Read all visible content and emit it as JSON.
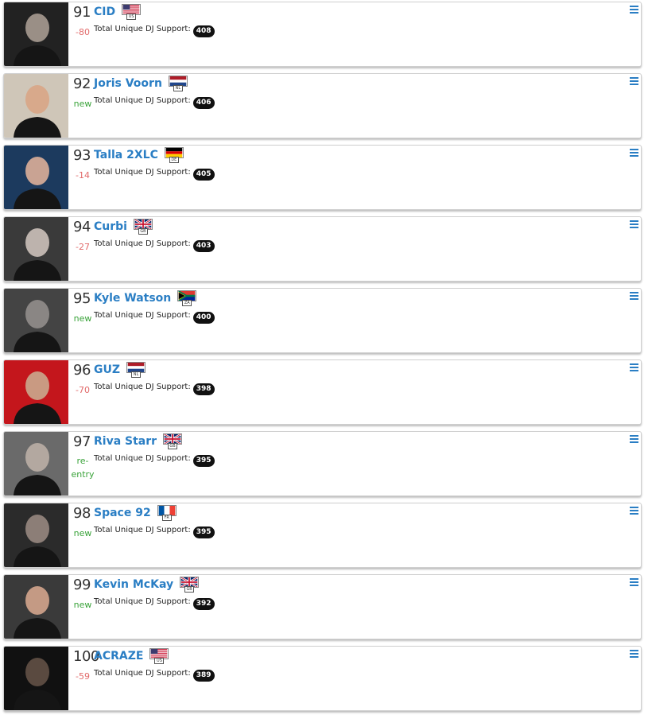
{
  "support_label": "Total Unique DJ Support:",
  "colors": {
    "name_link": "#2a7ec4",
    "down": "#e26b6b",
    "up": "#3aa33a"
  },
  "entries": [
    {
      "rank": "91",
      "name": "CID",
      "country": "US",
      "change": "-80",
      "change_type": "down",
      "support": "408",
      "photo_icon": "artist-photo"
    },
    {
      "rank": "92",
      "name": "Joris Voorn",
      "country": "NL",
      "change": "new",
      "change_type": "up",
      "support": "406",
      "photo_icon": "artist-photo"
    },
    {
      "rank": "93",
      "name": "Talla 2XLC",
      "country": "DE",
      "change": "-14",
      "change_type": "down",
      "support": "405",
      "photo_icon": "artist-photo"
    },
    {
      "rank": "94",
      "name": "Curbi",
      "country": "GB",
      "change": "-27",
      "change_type": "down",
      "support": "403",
      "photo_icon": "artist-photo"
    },
    {
      "rank": "95",
      "name": "Kyle Watson",
      "country": "ZA",
      "change": "new",
      "change_type": "up",
      "support": "400",
      "photo_icon": "artist-photo"
    },
    {
      "rank": "96",
      "name": "GUZ",
      "country": "NL",
      "change": "-70",
      "change_type": "down",
      "support": "398",
      "photo_icon": "artist-photo"
    },
    {
      "rank": "97",
      "name": "Riva Starr",
      "country": "GB",
      "change": "re-\nentry",
      "change_type": "up",
      "support": "395",
      "photo_icon": "artist-photo"
    },
    {
      "rank": "98",
      "name": "Space 92",
      "country": "FR",
      "change": "new",
      "change_type": "up",
      "support": "395",
      "photo_icon": "artist-photo"
    },
    {
      "rank": "99",
      "name": "Kevin McKay",
      "country": "GB",
      "change": "new",
      "change_type": "up",
      "support": "392",
      "photo_icon": "artist-photo"
    },
    {
      "rank": "100",
      "name": "ACRAZE",
      "country": "US",
      "change": "-59",
      "change_type": "down",
      "support": "389",
      "photo_icon": "artist-photo"
    }
  ]
}
